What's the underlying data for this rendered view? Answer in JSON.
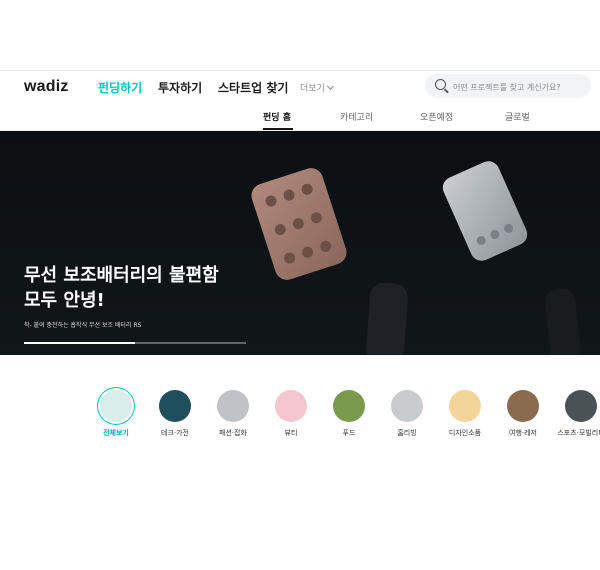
{
  "header": {
    "logo": "wadiz",
    "nav": [
      "펀딩하기",
      "투자하기",
      "스타트업 찾기"
    ],
    "more_label": "더보기",
    "search_placeholder": "어떤 프로젝트를 찾고 계신가요?"
  },
  "subnav": {
    "tabs": [
      "펀딩 홈",
      "카테고리",
      "오픈예정",
      "글로벌"
    ],
    "active": "펀딩 홈"
  },
  "hero": {
    "title_line1": "무선 보조배터리의 불편함",
    "title_line2": "모두 안녕!",
    "caption": "착- 붙여 충전하는 흡착식 무선 보조 배터리 RS",
    "progress_fraction": 0.5
  },
  "categories": [
    {
      "label": "전체보기",
      "color": "#d8efe9",
      "active": true
    },
    {
      "label": "테크·가전",
      "color": "#1f4f5c",
      "active": false
    },
    {
      "label": "패션·잡화",
      "color": "#bfc3c7",
      "active": false
    },
    {
      "label": "뷰티",
      "color": "#f3c6d0",
      "active": false
    },
    {
      "label": "푸드",
      "color": "#7a9a4e",
      "active": false
    },
    {
      "label": "홈리빙",
      "color": "#c9cccc",
      "active": false
    },
    {
      "label": "디자인소품",
      "color": "#f2d59a",
      "active": false
    },
    {
      "label": "여행·레저",
      "color": "#8a6b4f",
      "active": false
    },
    {
      "label": "스포츠·모빌리티",
      "color": "#4a5256",
      "active": false
    }
  ],
  "colors": {
    "accent": "#00c4c4",
    "hero_bg": "#0b0f12"
  }
}
